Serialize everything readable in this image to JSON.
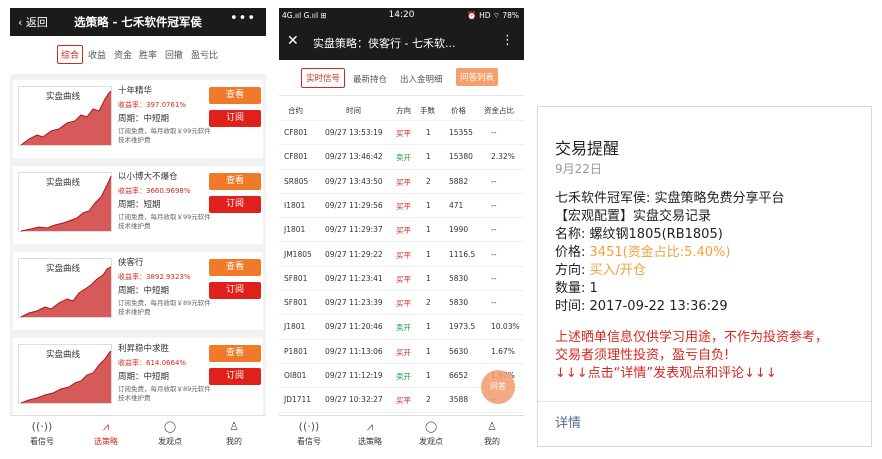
{
  "panel1": {
    "back_label": "返回",
    "title": "选策略 - 七禾软件冠军侯",
    "more_icon": "more-dots-icon",
    "tabs": [
      "综合",
      "收益",
      "资金",
      "胜率",
      "回撤",
      "盈亏比"
    ],
    "cards": [
      {
        "spark_label": "实盘曲线",
        "name": "十年精华",
        "rate": "收益率：397.0761%",
        "period": "周期：中短期",
        "fee": "订阅免费，每月收取￥99元软件技术维护费",
        "view": "查看",
        "subscribe": "订阅"
      },
      {
        "spark_label": "实盘曲线",
        "name": "以小博大不爆仓",
        "rate": "收益率：3660.9698%",
        "period": "周期：短期",
        "fee": "订阅免费，每月收取￥99元软件技术维护费",
        "view": "查看",
        "subscribe": "订阅"
      },
      {
        "spark_label": "实盘曲线",
        "name": "侠客行",
        "rate": "收益率：3892.9323%",
        "period": "周期：中短期",
        "fee": "订阅免费，每月收取￥89元软件技术维护费",
        "view": "查看",
        "subscribe": "订阅"
      },
      {
        "spark_label": "实盘曲线",
        "name": "利昇稳中求胜",
        "rate": "收益率：614.0664%",
        "period": "周期：中短期",
        "fee": "订阅免费，每月收取￥89元软件技术维护费",
        "view": "查看",
        "subscribe": "订阅"
      }
    ],
    "nav": [
      {
        "icon": "wifi-icon",
        "label": "看信号"
      },
      {
        "icon": "trend-chart-icon",
        "label": "选策略"
      },
      {
        "icon": "chat-bubble-icon",
        "label": "发观点"
      },
      {
        "icon": "user-icon",
        "label": "我的"
      }
    ]
  },
  "panel2": {
    "status_left": "4G.ııl G.ııl ⊞",
    "status_time": "14:20",
    "status_right": "⏰ HD ⌔ 78%",
    "title": "实盘策略：侠客行 - 七禾软...",
    "tabs": [
      "实时信号",
      "最新持仓",
      "出入金明细",
      "问答列表"
    ],
    "columns": [
      "合约",
      "时间",
      "方向",
      "手数",
      "价格",
      "资金占比"
    ],
    "rows": [
      [
        "CF801",
        "09/27 13:53:19",
        "买平",
        "1",
        "15355",
        "--"
      ],
      [
        "CF801",
        "09/27 13:46:42",
        "卖开",
        "1",
        "15380",
        "2.32%"
      ],
      [
        "SR805",
        "09/27 13:43:50",
        "买平",
        "2",
        "5882",
        "--"
      ],
      [
        "I1801",
        "09/27 11:29:56",
        "买平",
        "1",
        "471",
        "--"
      ],
      [
        "J1801",
        "09/27 11:29:37",
        "买平",
        "1",
        "1990",
        "--"
      ],
      [
        "JM1805",
        "09/27 11:29:22",
        "买平",
        "1",
        "1116.5",
        "--"
      ],
      [
        "SF801",
        "09/27 11:23:41",
        "买平",
        "1",
        "5830",
        "--"
      ],
      [
        "SF801",
        "09/27 11:23:39",
        "买平",
        "2",
        "5830",
        "--"
      ],
      [
        "J1801",
        "09/27 11:20:46",
        "卖开",
        "1",
        "1973.5",
        "10.03%"
      ],
      [
        "P1801",
        "09/27 11:13:06",
        "买开",
        "1",
        "5630",
        "1.67%"
      ],
      [
        "OI801",
        "09/27 11:12:19",
        "卖开",
        "1",
        "6652",
        "1.97%"
      ],
      [
        "JD1711",
        "09/27 10:32:27",
        "买平",
        "2",
        "3588",
        "--"
      ]
    ],
    "fab_label": "问答",
    "nav": [
      {
        "icon": "wifi-icon",
        "label": "看信号"
      },
      {
        "icon": "trend-chart-icon",
        "label": "选策略"
      },
      {
        "icon": "chat-bubble-icon",
        "label": "发观点"
      },
      {
        "icon": "user-icon",
        "label": "我的"
      }
    ]
  },
  "panel3": {
    "title": "交易提醒",
    "date": "9月22日",
    "line1": "七禾软件冠军侯: 实盘策略免费分享平台",
    "line2": "【宏观配置】实盘交易记录",
    "name_label": "名称:",
    "name_value": "螺纹钢1805(RB1805)",
    "price_label": "价格:",
    "price_value": "3451(资金占比:5.40%)",
    "dir_label": "方向:",
    "dir_value": "买入/开仓",
    "qty_label": "数量:",
    "qty_value": "1",
    "time_label": "时间:",
    "time_value": "2017-09-22 13:36:29",
    "warn1": "上述晒单信息仅供学习用途，不作为投资参考，",
    "warn2": "交易者须理性投资，盈亏自负!",
    "warn3": "↓↓↓点击“详情”发表观点和评论↓↓↓",
    "details": "详情"
  }
}
